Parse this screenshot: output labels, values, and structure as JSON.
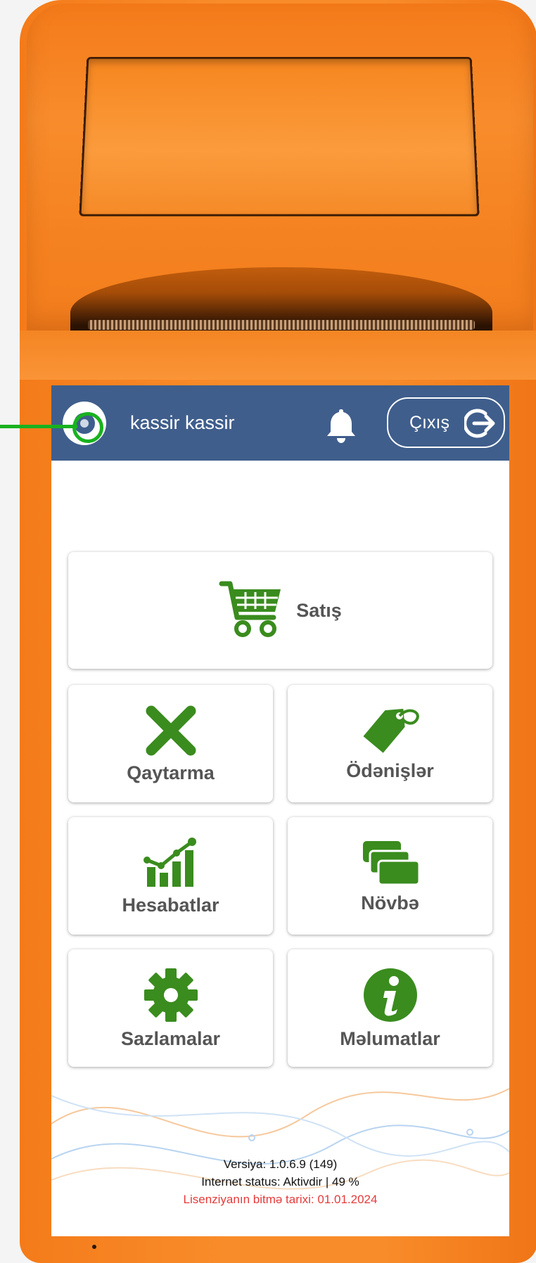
{
  "header": {
    "username": "kassir kassir",
    "logout_label": "Çıxış"
  },
  "menu": {
    "sales": "Satış",
    "returns": "Qaytarma",
    "payments": "Ödənişlər",
    "reports": "Hesabatlar",
    "shift": "Növbə",
    "settings": "Sazlamalar",
    "info": "Məlumatlar"
  },
  "footer": {
    "version": "Versiya: 1.0.6.9 (149)",
    "internet_status": "Internet status: Aktivdir | 49 %",
    "license_expiry": "Lisenziyanın bitmə tarixi: 01.01.2024"
  },
  "colors": {
    "header_bg": "#3f5e8c",
    "icon_green": "#3a8c1e",
    "license_red": "#e53b3b",
    "device_orange": "#f98c2a"
  }
}
